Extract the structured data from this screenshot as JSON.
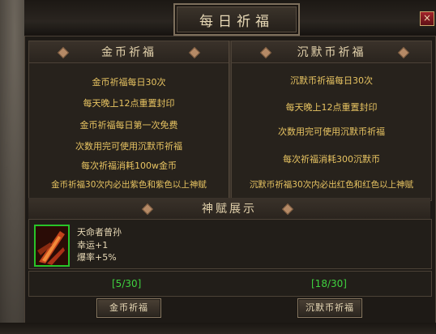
{
  "window": {
    "title": "每日祈福",
    "close_label": "×"
  },
  "left": {
    "header": "金币祈福",
    "lines": [
      "金币祈福每日30次",
      "每天晚上12点重置封印",
      "金币祈福每日第一次免费",
      "次数用完可使用沉默币祈福",
      "每次祈福消耗100w金币",
      "金币祈福30次内必出紫色和紫色以上神赋"
    ],
    "counter": "[5/30]",
    "button_label": "金币祈福"
  },
  "right": {
    "header": "沉默币祈福",
    "lines": [
      "沉默币祈福每日30次",
      "每天晚上12点重置封印",
      "次数用完可使用沉默币祈福",
      "每次祈福消耗300沉默币",
      "沉默币祈福30次内必出红色和红色以上神赋"
    ],
    "counter": "[18/30]",
    "button_label": "沉默币祈福"
  },
  "talent": {
    "header": "神赋展示",
    "name": "天命者曾孙",
    "luck": "幸运+1",
    "crit": "爆率+5%",
    "icon": "flame-slash-icon"
  },
  "colors": {
    "info_text": "#e8c462",
    "counter": "#3fd23f",
    "icon_border": "#28c428"
  }
}
